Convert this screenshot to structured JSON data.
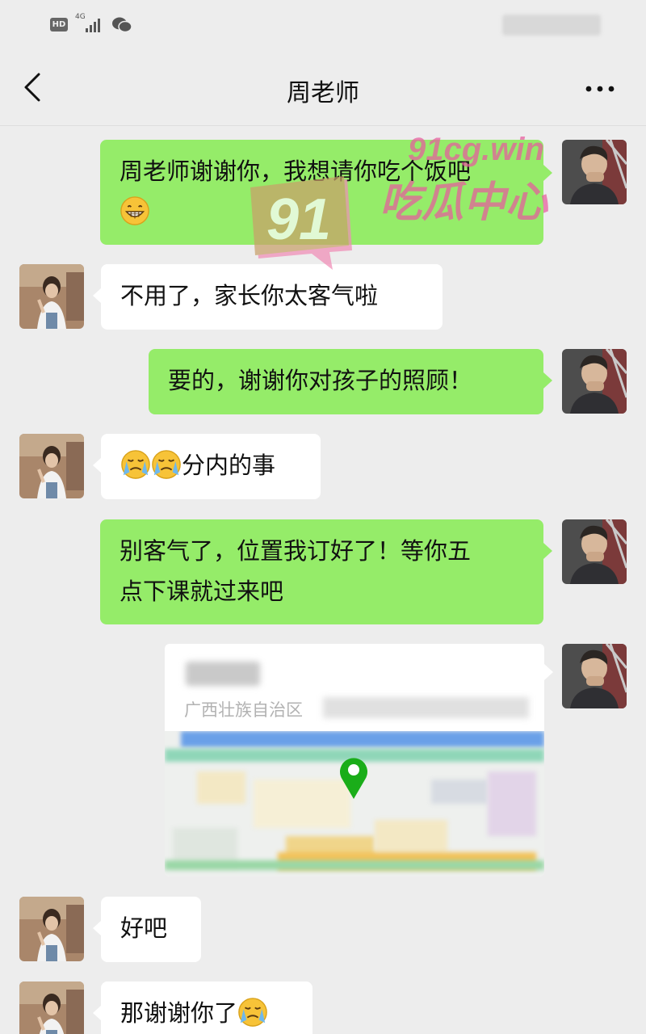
{
  "status_bar": {
    "hd": "HD",
    "network": "4G"
  },
  "header": {
    "title": "周老师"
  },
  "messages": [
    {
      "side": "out",
      "text": "周老师谢谢你，我想请你吃个饭吧",
      "emoji": "grinning-face"
    },
    {
      "side": "in",
      "text": "不用了，家长你太客气啦"
    },
    {
      "side": "out",
      "text": "要的，谢谢你对孩子的照顾！"
    },
    {
      "side": "in",
      "text": "分内的事",
      "emoji": "crying-face"
    },
    {
      "side": "out",
      "line1": "别客气了，位置我订好了！等你五",
      "line2": "点下课就过来吧"
    },
    {
      "side": "out",
      "type": "location",
      "address": "广西壮族自治区"
    },
    {
      "side": "in",
      "text": "好吧"
    },
    {
      "side": "in",
      "text": "那谢谢你了",
      "emoji": "crying-face"
    }
  ],
  "watermark": {
    "url": "91cg.win",
    "number": "91",
    "name": "吃瓜中心"
  },
  "colors": {
    "outgoing": "#95ec69",
    "incoming": "#ffffff",
    "background": "#ededed",
    "map_pin": "#1aad19"
  }
}
